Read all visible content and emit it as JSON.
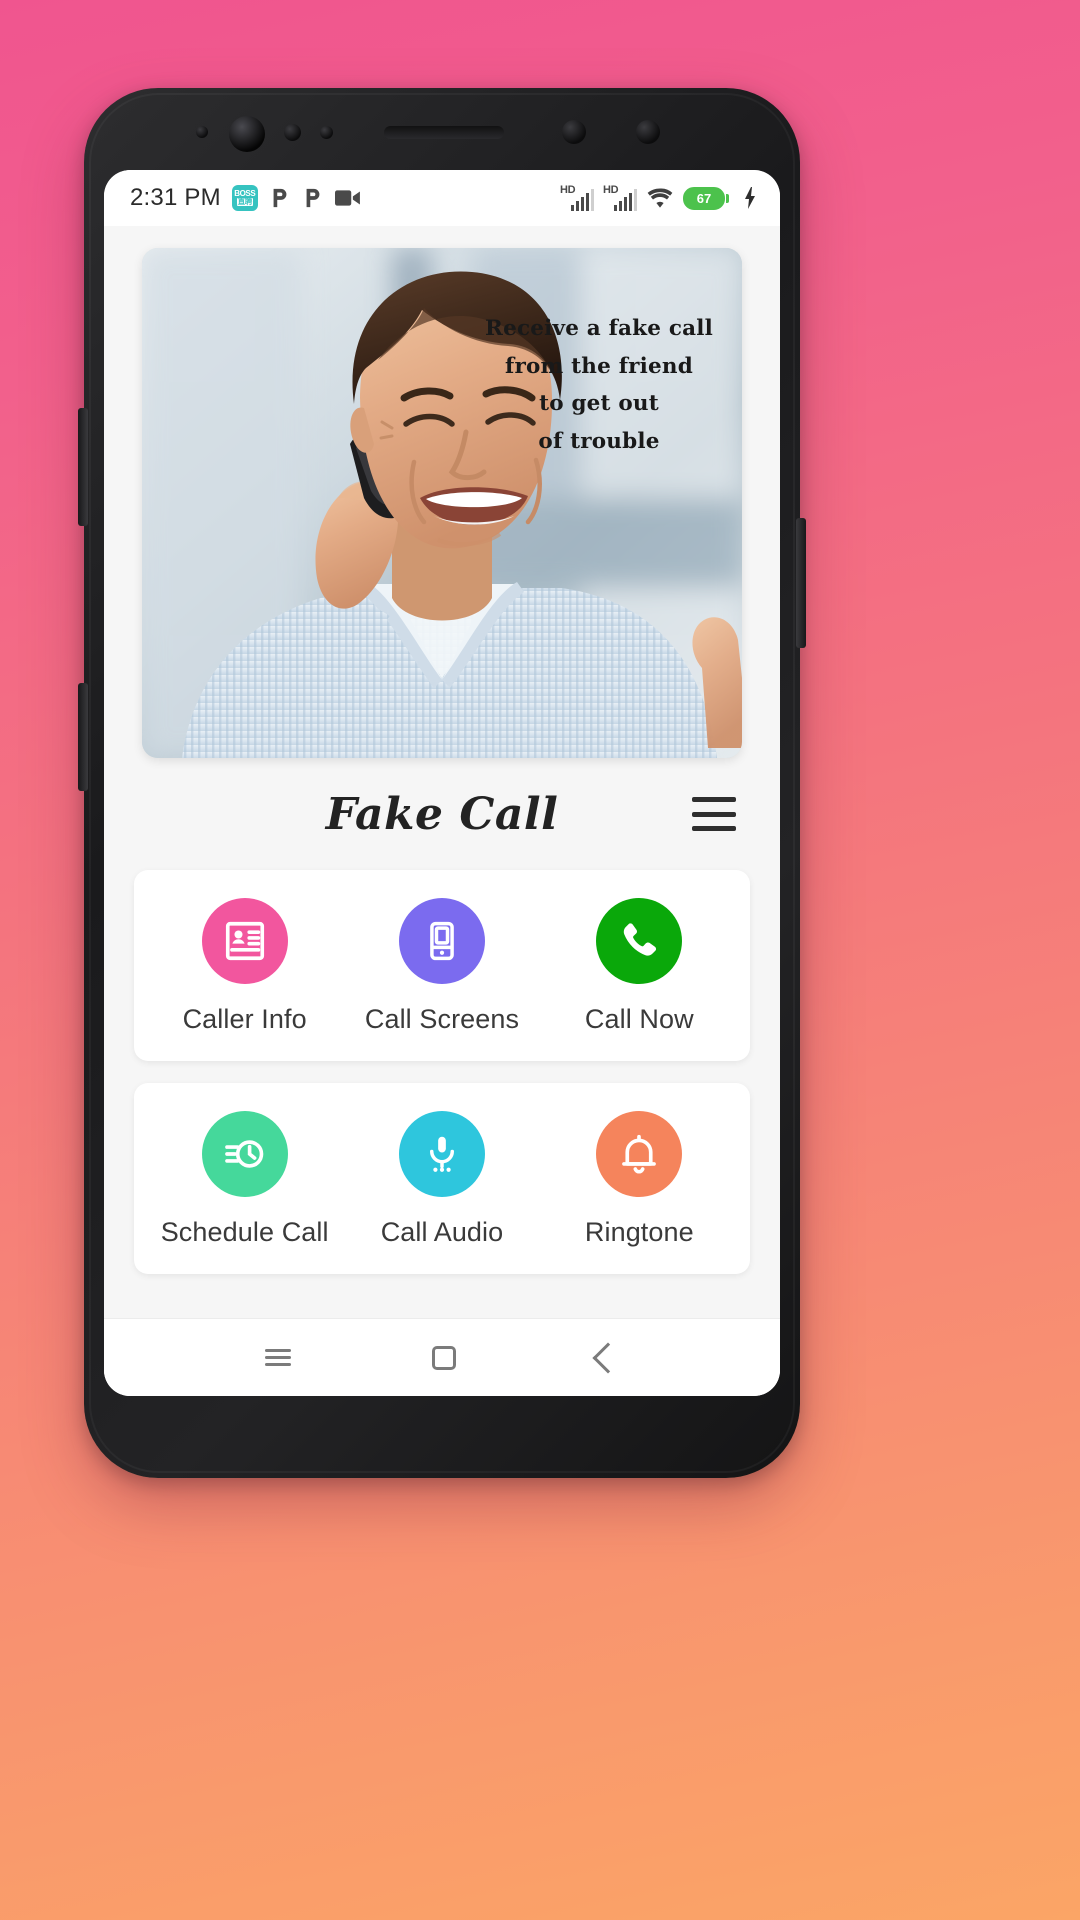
{
  "status_bar": {
    "time": "2:31 PM",
    "icons_left": [
      "boss-app-icon",
      "p-app-icon",
      "p-app-icon",
      "video-camera-icon"
    ],
    "boss_line1": "BOSS",
    "boss_line2": "直聘",
    "signal_1_label": "HD",
    "signal_2_label": "HD",
    "wifi": "wifi-icon",
    "battery_percent": "67",
    "charging": true,
    "battery_color": "#4cc24c"
  },
  "hero": {
    "alt": "smiling man talking on mobile phone",
    "caption_lines": [
      "Receive a fake call",
      "from the friend",
      "to get out",
      "of trouble"
    ]
  },
  "header": {
    "title": "Fake Call",
    "menu": "hamburger-menu-icon"
  },
  "actions": {
    "row1": [
      {
        "label": "Caller Info",
        "icon": "contact-card-icon",
        "color": "#f2569e"
      },
      {
        "label": "Call Screens",
        "icon": "mobile-screen-icon",
        "color": "#7b6bef"
      },
      {
        "label": "Call Now",
        "icon": "phone-handset-icon",
        "color": "#0aa80a"
      }
    ],
    "row2": [
      {
        "label": "Schedule Call",
        "icon": "clock-schedule-icon",
        "color": "#45d89b"
      },
      {
        "label": "Call Audio",
        "icon": "microphone-icon",
        "color": "#2ec6dd"
      },
      {
        "label": "Ringtone",
        "icon": "bell-icon",
        "color": "#f5845c"
      }
    ]
  },
  "nav_bar": {
    "recent": "recent-apps-icon",
    "home": "home-icon",
    "back": "back-icon"
  },
  "theme": {
    "bg_gradient_start": "#f0558f",
    "bg_gradient_end": "#fba566",
    "screen_bg": "#f6f6f6",
    "card_bg": "#ffffff"
  }
}
